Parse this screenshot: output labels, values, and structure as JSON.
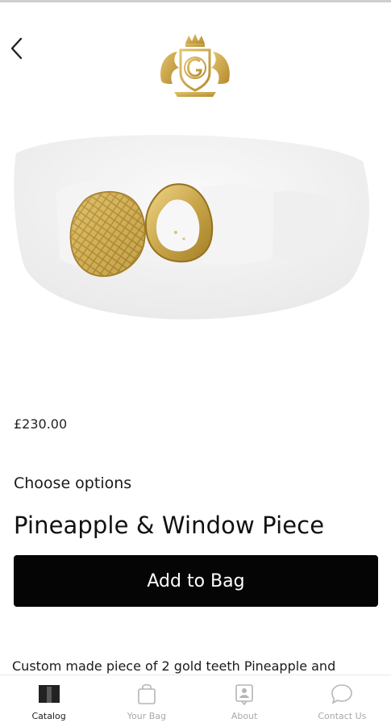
{
  "header": {
    "back_icon": "chevron-left-icon",
    "logo_icon": "gold-crest-logo"
  },
  "product": {
    "price": "£230.00",
    "options_label": "Choose options",
    "title": "Pineapple & Window Piece",
    "add_button_label": "Add to Bag",
    "description": "Custom made piece of 2 gold teeth Pineapple and"
  },
  "nav": {
    "items": [
      {
        "label": "Catalog",
        "icon": "catalog-icon",
        "active": true
      },
      {
        "label": "Your Bag",
        "icon": "bag-icon",
        "active": false
      },
      {
        "label": "About",
        "icon": "about-icon",
        "active": false
      },
      {
        "label": "Contact Us",
        "icon": "chat-icon",
        "active": false
      }
    ]
  },
  "colors": {
    "accent": "#000000",
    "gold": "#c9a54a",
    "nav_inactive": "#a9a9a9"
  }
}
